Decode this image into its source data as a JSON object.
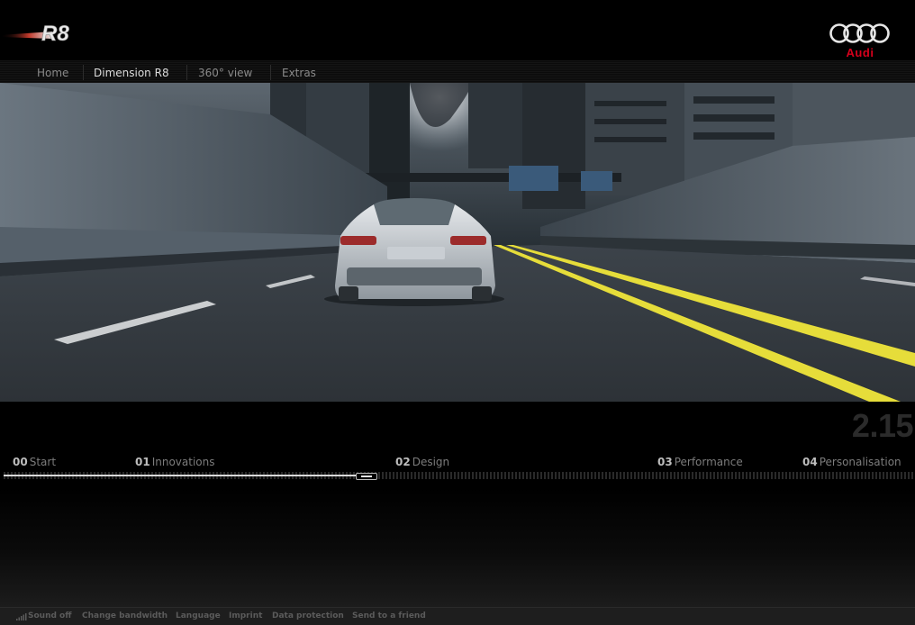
{
  "header": {
    "model_logo": "R8",
    "brand_wordmark": "Audi",
    "brand_color": "#d6001c"
  },
  "nav": {
    "items": [
      {
        "label": "Home",
        "active": false
      },
      {
        "label": "Dimension R8",
        "active": true
      },
      {
        "label": "360° view",
        "active": false
      },
      {
        "label": "Extras",
        "active": false
      }
    ]
  },
  "player": {
    "timecode": "2.15",
    "progress_fraction": 0.39,
    "chapters": [
      {
        "num": "00",
        "label": "Start"
      },
      {
        "num": "01",
        "label": "Innovations"
      },
      {
        "num": "02",
        "label": "Design"
      },
      {
        "num": "03",
        "label": "Performance"
      },
      {
        "num": "04",
        "label": "Personalisation"
      }
    ]
  },
  "footer": {
    "items": [
      "Sound off",
      "Change bandwidth",
      "Language",
      "Imprint",
      "Data protection",
      "Send to a friend"
    ],
    "sound_icon": "sound-bars-icon"
  }
}
